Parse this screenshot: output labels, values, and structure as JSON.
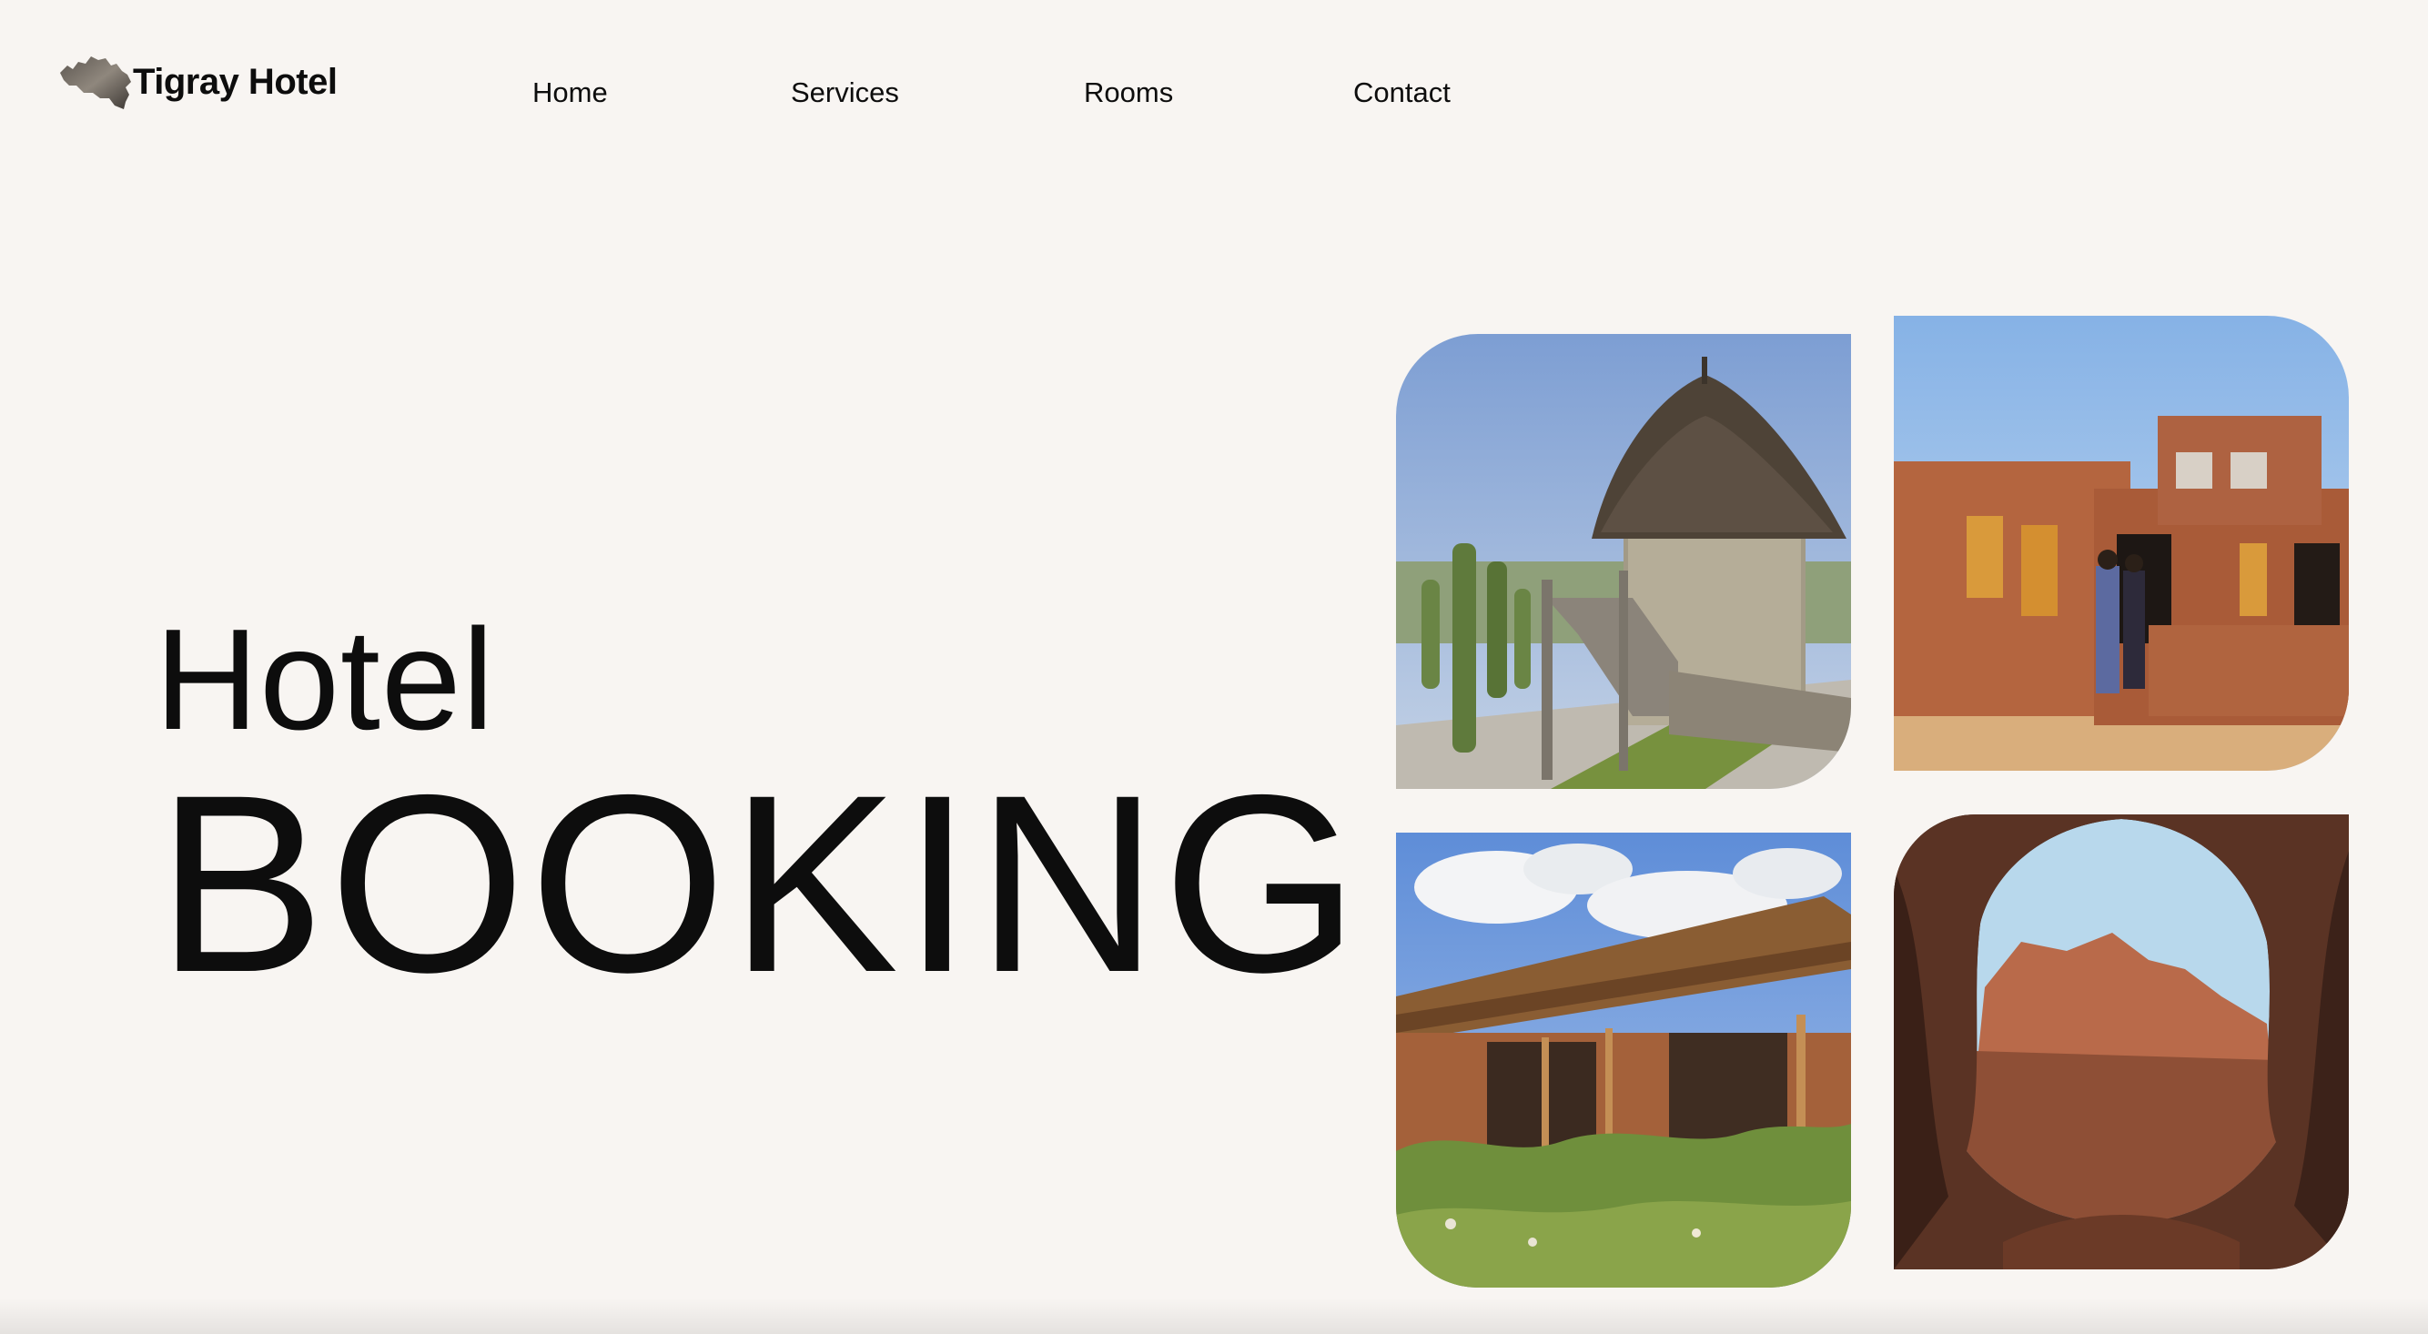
{
  "brand": {
    "name": "Tigray Hotel",
    "logo_icon": "tigray-map-icon"
  },
  "nav": {
    "items": [
      {
        "label": "Home"
      },
      {
        "label": "Services"
      },
      {
        "label": "Rooms"
      },
      {
        "label": "Contact"
      }
    ]
  },
  "hero": {
    "line1": "Hotel",
    "line2": "BOOKING"
  },
  "gallery": {
    "images": [
      {
        "icon": "thatched-roundhouse-photo"
      },
      {
        "icon": "stone-house-photo"
      },
      {
        "icon": "lodge-garden-photo"
      },
      {
        "icon": "rock-arch-canyon-photo"
      }
    ]
  },
  "colors": {
    "background": "#f8f5f2",
    "text": "#0d0d0d"
  }
}
